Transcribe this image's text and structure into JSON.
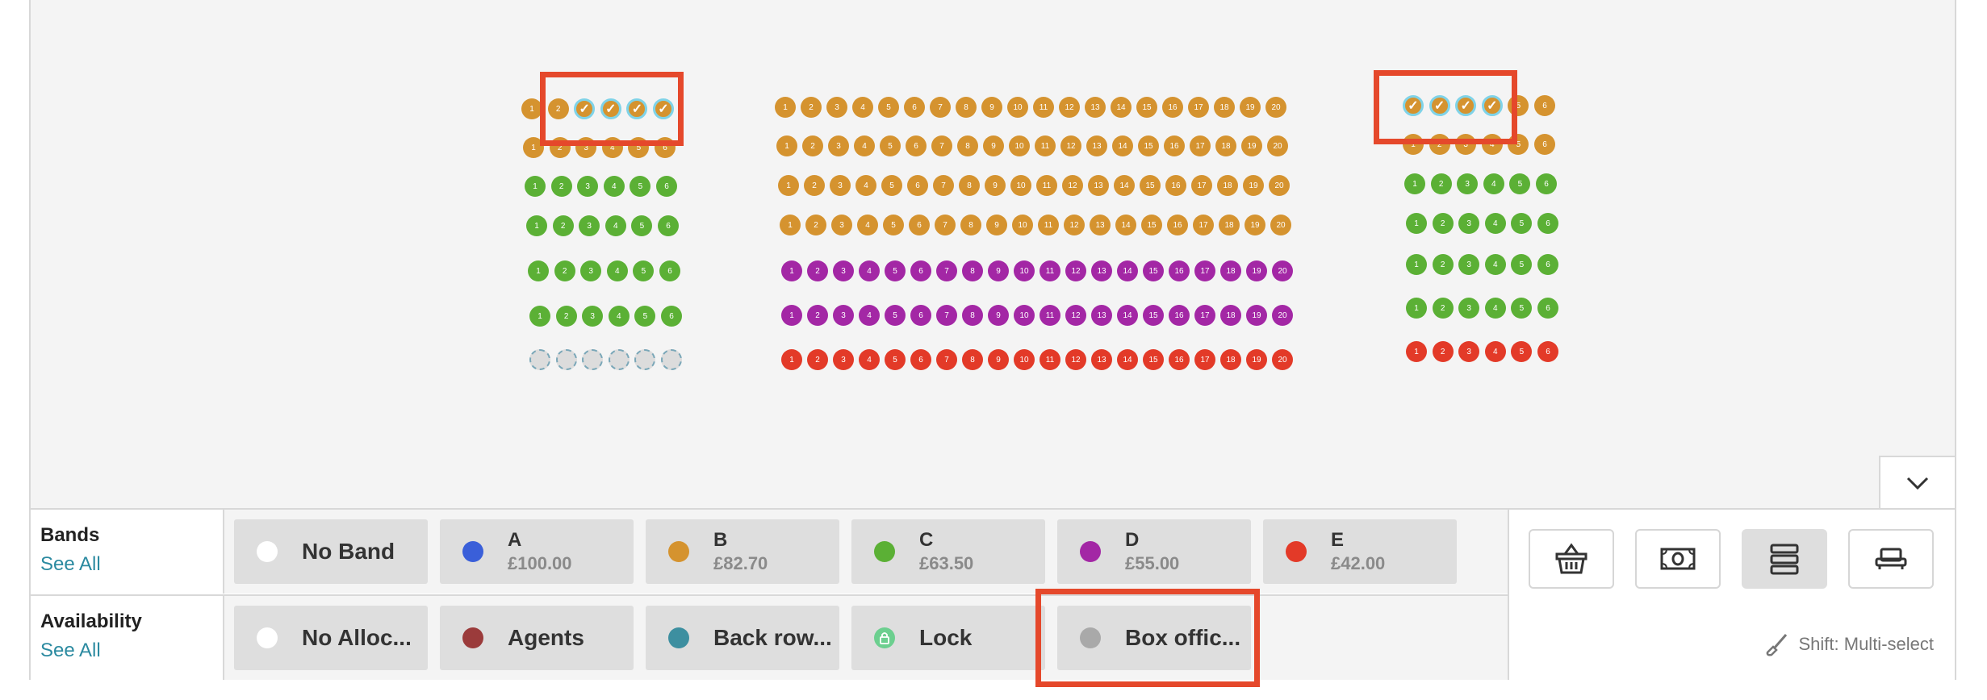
{
  "seatmap": {
    "colors": {
      "A": "#3a5fd9",
      "B": "#d5932f",
      "C": "#5bb035",
      "D": "#a327a5",
      "E": "#e33a28",
      "unallocated": "#dcdcdc",
      "selected_ring": "#7fd3e8"
    },
    "selected_mark": "✓",
    "blocks": [
      {
        "name": "left",
        "rows": [
          {
            "band": "B",
            "seats": [
              "1",
              "2",
              "",
              "",
              "",
              ""
            ],
            "selected": [
              2,
              3,
              4,
              5
            ]
          },
          {
            "band": "B",
            "seats": [
              "1",
              "2",
              "3",
              "4",
              "5",
              "6"
            ]
          },
          {
            "band": "C",
            "seats": [
              "1",
              "2",
              "3",
              "4",
              "5",
              "6"
            ]
          },
          {
            "band": "C",
            "seats": [
              "1",
              "2",
              "3",
              "4",
              "5",
              "6"
            ]
          },
          {
            "band": "C",
            "seats": [
              "1",
              "2",
              "3",
              "4",
              "5",
              "6"
            ]
          },
          {
            "band": "C",
            "seats": [
              "1",
              "2",
              "3",
              "4",
              "5",
              "6"
            ]
          },
          {
            "band": "unallocated",
            "seats": [
              "",
              "",
              "",
              "",
              "",
              ""
            ]
          }
        ]
      },
      {
        "name": "center",
        "rows": [
          {
            "band": "B",
            "seats": [
              "1",
              "2",
              "3",
              "4",
              "5",
              "6",
              "7",
              "8",
              "9",
              "10",
              "11",
              "12",
              "13",
              "14",
              "15",
              "16",
              "17",
              "18",
              "19",
              "20"
            ]
          },
          {
            "band": "B",
            "seats": [
              "1",
              "2",
              "3",
              "4",
              "5",
              "6",
              "7",
              "8",
              "9",
              "10",
              "11",
              "12",
              "13",
              "14",
              "15",
              "16",
              "17",
              "18",
              "19",
              "20"
            ]
          },
          {
            "band": "B",
            "seats": [
              "1",
              "2",
              "3",
              "4",
              "5",
              "6",
              "7",
              "8",
              "9",
              "10",
              "11",
              "12",
              "13",
              "14",
              "15",
              "16",
              "17",
              "18",
              "19",
              "20"
            ]
          },
          {
            "band": "B",
            "seats": [
              "1",
              "2",
              "3",
              "4",
              "5",
              "6",
              "7",
              "8",
              "9",
              "10",
              "11",
              "12",
              "13",
              "14",
              "15",
              "16",
              "17",
              "18",
              "19",
              "20"
            ]
          },
          {
            "band": "D",
            "seats": [
              "1",
              "2",
              "3",
              "4",
              "5",
              "6",
              "7",
              "8",
              "9",
              "10",
              "11",
              "12",
              "13",
              "14",
              "15",
              "16",
              "17",
              "18",
              "19",
              "20"
            ]
          },
          {
            "band": "D",
            "seats": [
              "1",
              "2",
              "3",
              "4",
              "5",
              "6",
              "7",
              "8",
              "9",
              "10",
              "11",
              "12",
              "13",
              "14",
              "15",
              "16",
              "17",
              "18",
              "19",
              "20"
            ]
          },
          {
            "band": "E",
            "seats": [
              "1",
              "2",
              "3",
              "4",
              "5",
              "6",
              "7",
              "8",
              "9",
              "10",
              "11",
              "12",
              "13",
              "14",
              "15",
              "16",
              "17",
              "18",
              "19",
              "20"
            ]
          }
        ]
      },
      {
        "name": "right",
        "rows": [
          {
            "band": "B",
            "seats": [
              "",
              "",
              "",
              "",
              "5",
              "6"
            ],
            "selected": [
              0,
              1,
              2,
              3
            ]
          },
          {
            "band": "B",
            "seats": [
              "1",
              "2",
              "3",
              "4",
              "5",
              "6"
            ]
          },
          {
            "band": "C",
            "seats": [
              "1",
              "2",
              "3",
              "4",
              "5",
              "6"
            ]
          },
          {
            "band": "C",
            "seats": [
              "1",
              "2",
              "3",
              "4",
              "5",
              "6"
            ]
          },
          {
            "band": "C",
            "seats": [
              "1",
              "2",
              "3",
              "4",
              "5",
              "6"
            ]
          },
          {
            "band": "C",
            "seats": [
              "1",
              "2",
              "3",
              "4",
              "5",
              "6"
            ]
          },
          {
            "band": "E",
            "seats": [
              "1",
              "2",
              "3",
              "4",
              "5",
              "6"
            ]
          }
        ]
      }
    ]
  },
  "bands": {
    "title": "Bands",
    "see_all": "See All",
    "items": [
      {
        "name": "No Band",
        "price": "",
        "color": "#ffffff"
      },
      {
        "name": "A",
        "price": "£100.00",
        "color": "#3a5fd9"
      },
      {
        "name": "B",
        "price": "£82.70",
        "color": "#d5932f"
      },
      {
        "name": "C",
        "price": "£63.50",
        "color": "#5bb035"
      },
      {
        "name": "D",
        "price": "£55.00",
        "color": "#a327a5"
      },
      {
        "name": "E",
        "price": "£42.00",
        "color": "#e33a28"
      }
    ]
  },
  "availability": {
    "title": "Availability",
    "see_all": "See All",
    "items": [
      {
        "name": "No Alloc...",
        "color": "#ffffff",
        "icon": "circle"
      },
      {
        "name": "Agents",
        "color": "#9b3b3b",
        "icon": "circle"
      },
      {
        "name": "Back row...",
        "color": "#3d8fa0",
        "icon": "circle"
      },
      {
        "name": "Lock",
        "color": "#6ccf8f",
        "icon": "lock-icon"
      },
      {
        "name": "Box offic...",
        "color": "#a9a9a9",
        "icon": "circle"
      }
    ]
  },
  "tools": {
    "buttons": [
      "basket-icon",
      "cash-icon",
      "rows-icon",
      "seat-icon"
    ],
    "active": "rows-icon",
    "hint": "Shift: Multi-select",
    "hint_icon": "brush-icon",
    "collapse_icon": "chevron-down-icon"
  }
}
